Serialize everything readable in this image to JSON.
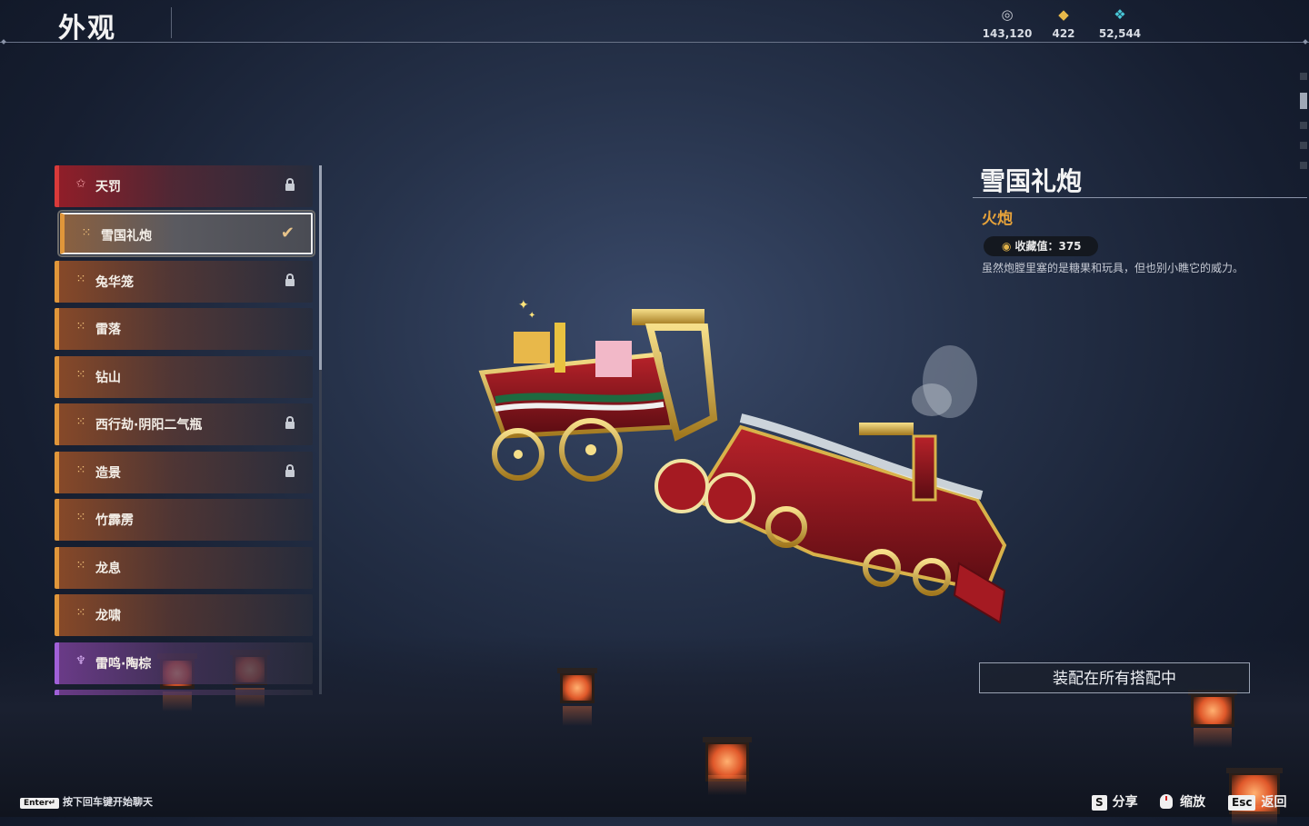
{
  "page_title": "外观",
  "currencies": [
    {
      "icon": "silver-coin-icon",
      "value": "143,120"
    },
    {
      "icon": "gold-ticket-icon",
      "value": "422"
    },
    {
      "icon": "feather-crystal-icon",
      "value": "52,544"
    }
  ],
  "list": {
    "items": [
      {
        "label": "天罚",
        "rarity": "red",
        "locked": true,
        "selected": false
      },
      {
        "label": "雪国礼炮",
        "rarity": "orange",
        "locked": false,
        "selected": true
      },
      {
        "label": "兔华笼",
        "rarity": "orange",
        "locked": true,
        "selected": false
      },
      {
        "label": "雷落",
        "rarity": "orange",
        "locked": false,
        "selected": false
      },
      {
        "label": "钻山",
        "rarity": "orange",
        "locked": false,
        "selected": false
      },
      {
        "label": "西行劫·阴阳二气瓶",
        "rarity": "orange",
        "locked": true,
        "selected": false
      },
      {
        "label": "造景",
        "rarity": "orange",
        "locked": true,
        "selected": false
      },
      {
        "label": "竹霹雳",
        "rarity": "orange",
        "locked": false,
        "selected": false
      },
      {
        "label": "龙息",
        "rarity": "orange",
        "locked": false,
        "selected": false
      },
      {
        "label": "龙啸",
        "rarity": "orange",
        "locked": false,
        "selected": false
      },
      {
        "label": "雷鸣·陶棕",
        "rarity": "purple",
        "locked": false,
        "selected": false
      }
    ]
  },
  "detail": {
    "name": "雪国礼炮",
    "type": "火炮",
    "collect_label": "收藏值：375",
    "description": "虽然炮膛里塞的是糖果和玩具，但也别小瞧它的威力。",
    "equip_button": "装配在所有搭配中"
  },
  "footer": {
    "enter_key": "Enter↵",
    "chat_hint": "按下回车键开始聊天",
    "share_key": "S",
    "share_label": "分享",
    "zoom_label": "缩放",
    "back_key": "Esc",
    "back_label": "返回"
  }
}
